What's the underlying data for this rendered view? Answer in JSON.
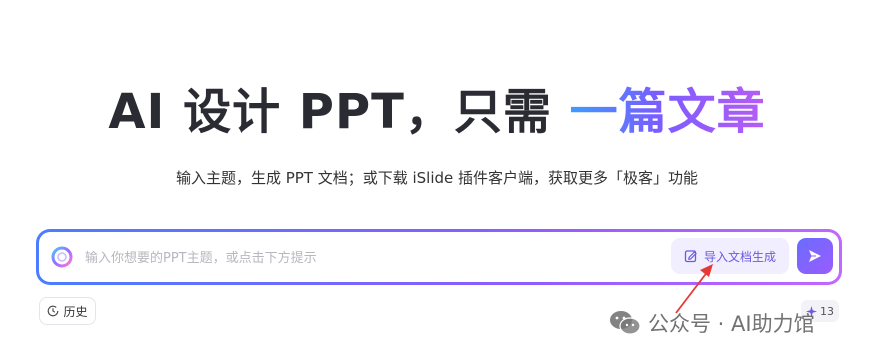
{
  "headline": {
    "part1": "AI 设计 PPT，只需 ",
    "part2": "一篇文章"
  },
  "subtitle": "输入主题，生成 PPT 文档；或下载 iSlide 插件客户端，获取更多「极客」功能",
  "prompt_bar": {
    "placeholder": "输入你想要的PPT主题，或点击下方提示",
    "import_label": "导入文档生成",
    "logo_icon": "islide-logo-icon",
    "import_icon": "edit-document-icon",
    "send_icon": "send-arrow-icon"
  },
  "history": {
    "label": "历史",
    "icon": "clock-icon"
  },
  "credits": {
    "count": "13",
    "icon": "sparkle-icon"
  },
  "watermark": {
    "text": "公众号 · AI助力馆",
    "icon": "wechat-icon"
  },
  "colors": {
    "accent_start": "#3d9bff",
    "accent_end": "#b75cf5",
    "annotation": "#e53935",
    "button_bg": "#f1efff"
  }
}
